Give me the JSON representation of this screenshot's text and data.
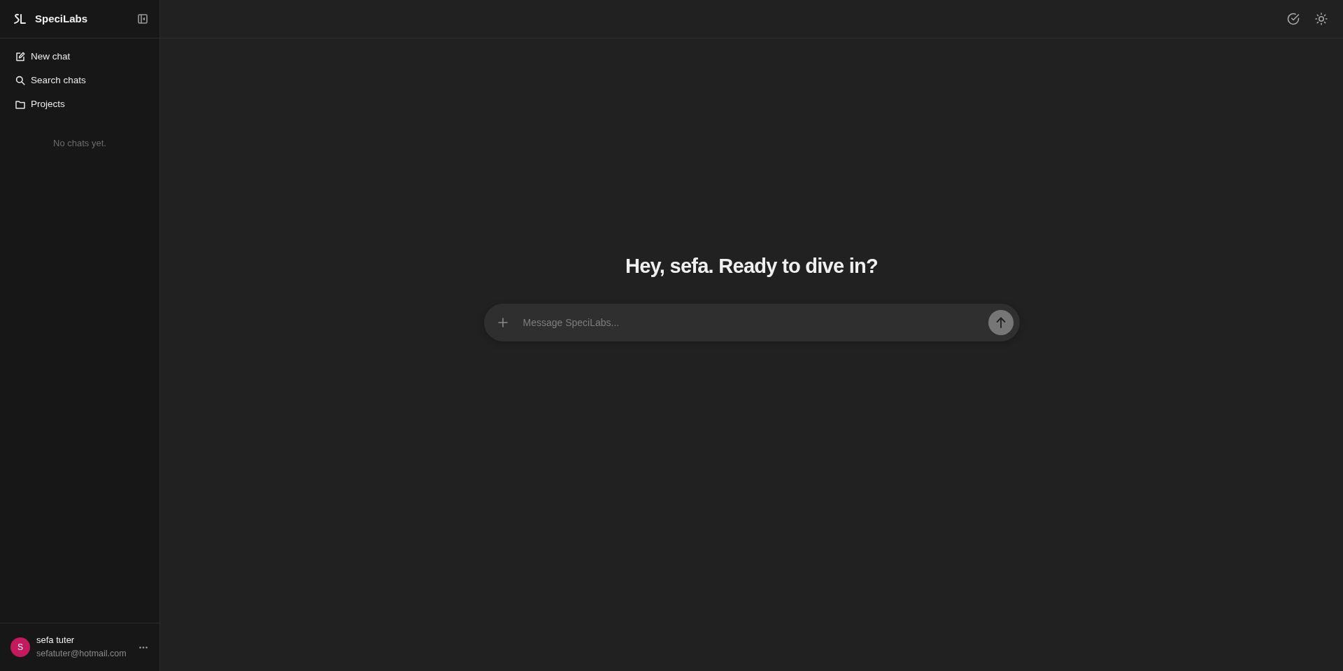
{
  "sidebar": {
    "brand": "SpeciLabs",
    "nav_items": [
      {
        "label": "New chat"
      },
      {
        "label": "Search chats"
      },
      {
        "label": "Projects"
      }
    ],
    "empty_message": "No chats yet.",
    "user": {
      "initial": "S",
      "name": "sefa tuter",
      "email": "sefatuter@hotmail.com"
    }
  },
  "main": {
    "greeting": "Hey, sefa. Ready to dive in?",
    "composer": {
      "placeholder": "Message SpeciLabs..."
    }
  }
}
